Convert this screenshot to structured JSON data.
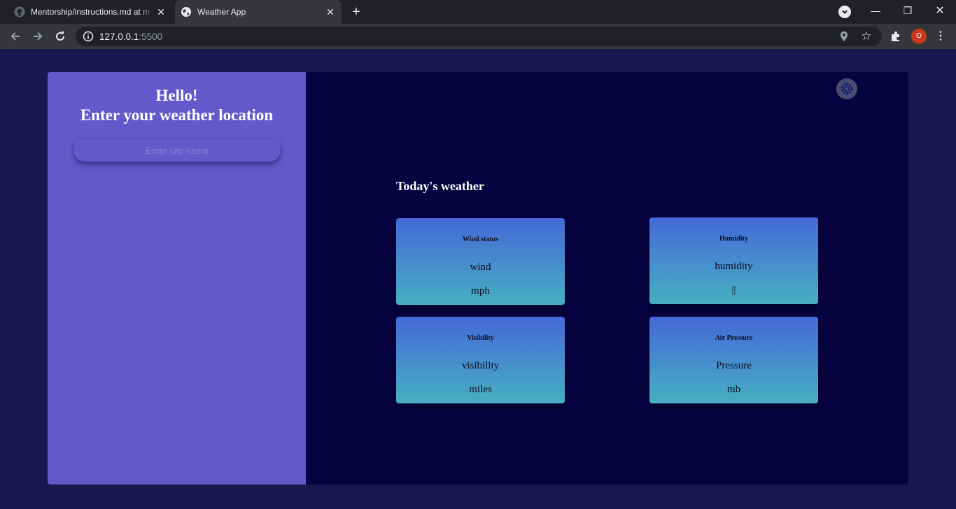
{
  "browser": {
    "tabs": [
      {
        "title": "Mentorship/instructions.md at m",
        "active": false
      },
      {
        "title": "Weather App",
        "active": true
      }
    ],
    "url_host": "127.0.0.1",
    "url_port": ":5500",
    "profile_initial": "O"
  },
  "app": {
    "greeting_line1": "Hello!",
    "greeting_line2": "Enter your weather location",
    "search_placeholder": "Enter city name",
    "section_title": "Today's weather",
    "cards": [
      {
        "title": "Wind status",
        "value": "wind",
        "unit": "mph"
      },
      {
        "title": "Humidity",
        "value": "humidity",
        "unit": "||"
      },
      {
        "title": "Visibility",
        "value": "visibility",
        "unit": "miles"
      },
      {
        "title": "Air Pressure",
        "value": "Pressure",
        "unit": "mb"
      }
    ]
  },
  "colors": {
    "page_bg": "#1a1650",
    "left_panel": "#6558ca",
    "right_panel": "#060340",
    "card_top": "#4469d8",
    "card_bottom": "#47afc2"
  }
}
